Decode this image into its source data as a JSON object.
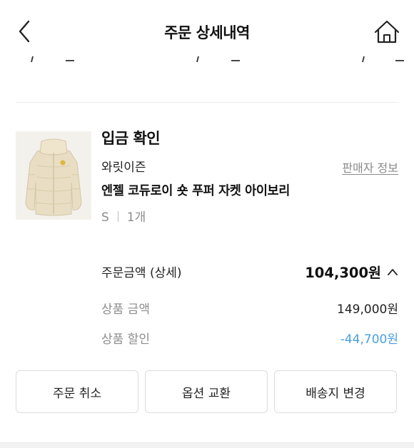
{
  "header": {
    "title": "주문 상세내역",
    "back_icon": "chevron-left-icon",
    "home_icon": "home-icon"
  },
  "order": {
    "status": "입금 확인",
    "brand": "와릿이즌",
    "seller_info_label": "판매자 정보",
    "product_name": "엔젤 코듀로이 숏 푸퍼 자켓 아이보리",
    "size": "S",
    "quantity": "1개"
  },
  "summary": {
    "total_label": "주문금액 (상세)",
    "total_value": "104,300원",
    "price_label": "상품 금액",
    "price_value": "149,000원",
    "discount_label": "상품 할인",
    "discount_value": "-44,700원"
  },
  "actions": {
    "cancel_label": "주문 취소",
    "exchange_label": "옵션 교환",
    "address_label": "배송지 변경"
  },
  "colors": {
    "discount": "#4a9ee0",
    "muted": "#8d8d8d"
  }
}
